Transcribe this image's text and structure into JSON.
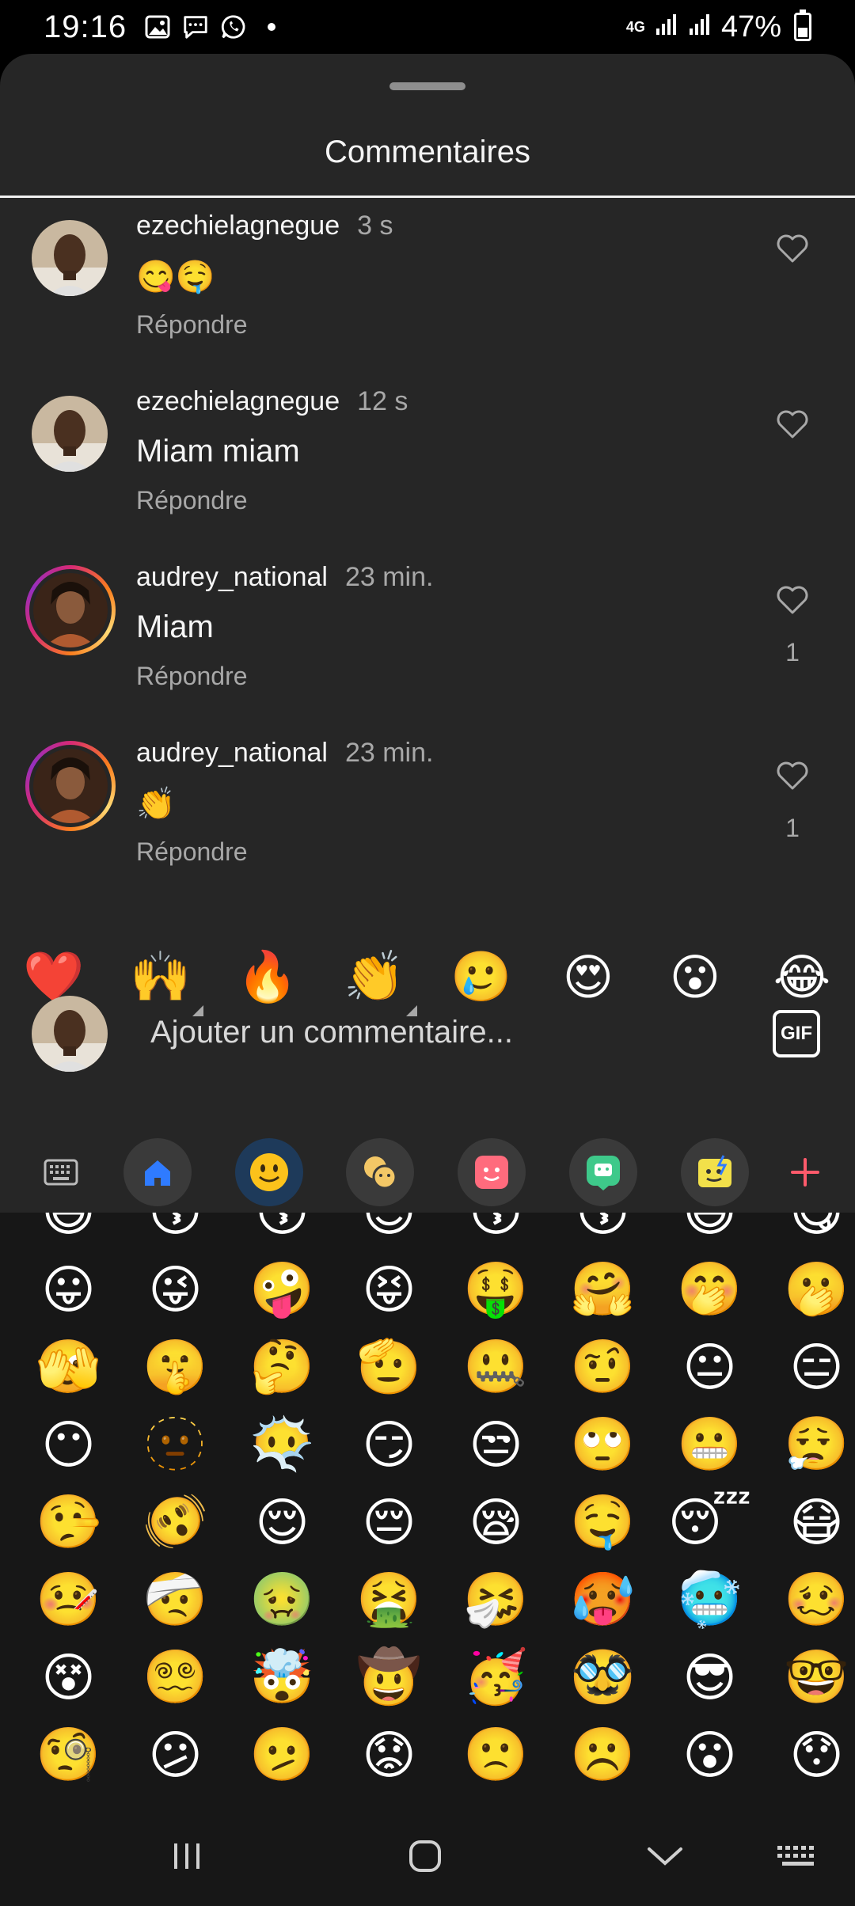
{
  "status_bar": {
    "time": "19:16",
    "network": "4G",
    "battery": "47%",
    "battery_level": 0.47
  },
  "sheet": {
    "title": "Commentaires"
  },
  "comments": [
    {
      "username": "ezechielagnegue",
      "time": "3 s",
      "text": "😋🤤",
      "reply": "Répondre",
      "likes": ""
    },
    {
      "username": "ezechielagnegue",
      "time": "12 s",
      "text": "Miam miam",
      "reply": "Répondre",
      "likes": ""
    },
    {
      "username": "audrey_national",
      "time": "23 min.",
      "text": "Miam",
      "reply": "Répondre",
      "likes": "1"
    },
    {
      "username": "audrey_national",
      "time": "23 min.",
      "text": "👏",
      "reply": "Répondre",
      "likes": "1"
    }
  ],
  "quick_reactions": [
    "❤️",
    "🙌",
    "🔥",
    "👏",
    "🥲",
    "😍",
    "😮",
    "😂"
  ],
  "input": {
    "placeholder": "Ajouter un commentaire...",
    "gif_label": "GIF"
  },
  "keyboard_toolbar": {
    "icons": [
      "keyboard-icon",
      "home-icon",
      "emoji-icon",
      "emoji-faces-icon",
      "sticker-icon",
      "bitmoji-icon",
      "ar-emoji-icon",
      "add-icon"
    ],
    "accent_color": "#ff5a6b",
    "active_color": "#1e3a5a"
  },
  "emoji_grid": [
    "😄",
    "😚",
    "😗",
    "😊",
    "😙",
    "😗",
    "😅",
    "😋",
    "😛",
    "😜",
    "🤪",
    "😝",
    "🤑",
    "🤗",
    "🤭",
    "🫢",
    "🫣",
    "🤫",
    "🤔",
    "🫡",
    "🤐",
    "🤨",
    "😐",
    "😑",
    "😶",
    "🫥",
    "😶‍🌫️",
    "😏",
    "😒",
    "🙄",
    "😬",
    "😮‍💨",
    "🤥",
    "🫨",
    "😌",
    "😔",
    "😪",
    "🤤",
    "😴",
    "😷",
    "🤒",
    "🤕",
    "🤢",
    "🤮",
    "🤧",
    "🥵",
    "🥶",
    "🥴",
    "😵",
    "😵‍💫",
    "🤯",
    "🤠",
    "🥳",
    "🥸",
    "😎",
    "🤓",
    "🧐",
    "😕",
    "🫤",
    "😟",
    "🙁",
    "☹️",
    "😮",
    "😯"
  ],
  "nav_bar": {
    "icons": [
      "recents-icon",
      "home-icon",
      "back-icon",
      "keyboard-switch-icon"
    ]
  }
}
